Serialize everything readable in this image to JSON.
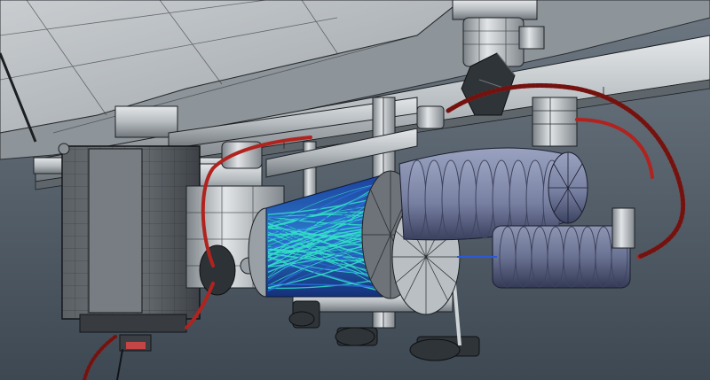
{
  "scene": {
    "type": "3d-wireframe-render",
    "colors": {
      "background_top": "#66727c",
      "background_bottom": "#3f4a54",
      "metal_light": "#d9dde0",
      "metal_mid": "#a9b0b5",
      "metal_dark": "#5d646a",
      "housing": "#4f5459",
      "coil_blue": "#7b84a6",
      "coil_dark": "#3e4560",
      "fiber_cyan": "#32e0c8",
      "fiber_blue": "#2a6ad8",
      "cable_red": "#b0231f",
      "wire": "#1b1e22"
    },
    "objects": [
      "ceiling-panel",
      "mounting-rail",
      "motor-housing",
      "fiber-cylinder",
      "cable-coil-upper",
      "cable-coil-lower",
      "pivot-bracket",
      "support-frame",
      "red-cable",
      "adjustment-knob"
    ]
  }
}
